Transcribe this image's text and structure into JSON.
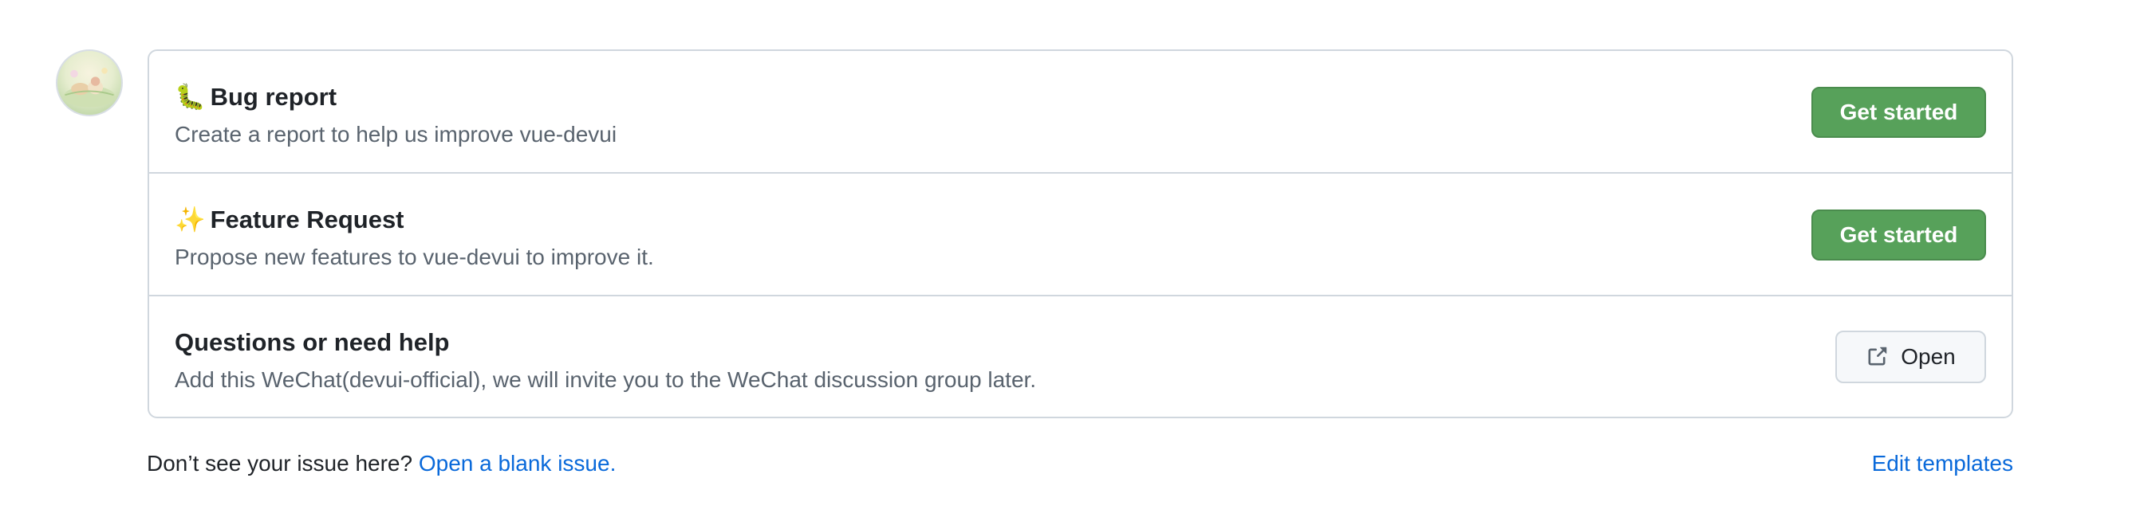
{
  "templates": [
    {
      "emoji": "🐛",
      "title": "Bug report",
      "description": "Create a report to help us improve vue-devui",
      "button_label": "Get started"
    },
    {
      "emoji": "✨",
      "title": "Feature Request",
      "description": "Propose new features to vue-devui to improve it.",
      "button_label": "Get started"
    },
    {
      "emoji": "",
      "title": "Questions or need help",
      "description": "Add this WeChat(devui-official), we will invite you to the WeChat discussion group later.",
      "button_label": "Open",
      "button_icon": "link-external-icon"
    }
  ],
  "footer": {
    "prompt": "Don’t see your issue here?",
    "blank_issue_link": "Open a blank issue.",
    "edit_templates_link": "Edit templates"
  },
  "colors": {
    "primary_button": "#57a15a",
    "link": "#0969da",
    "border": "#d0d7de"
  }
}
